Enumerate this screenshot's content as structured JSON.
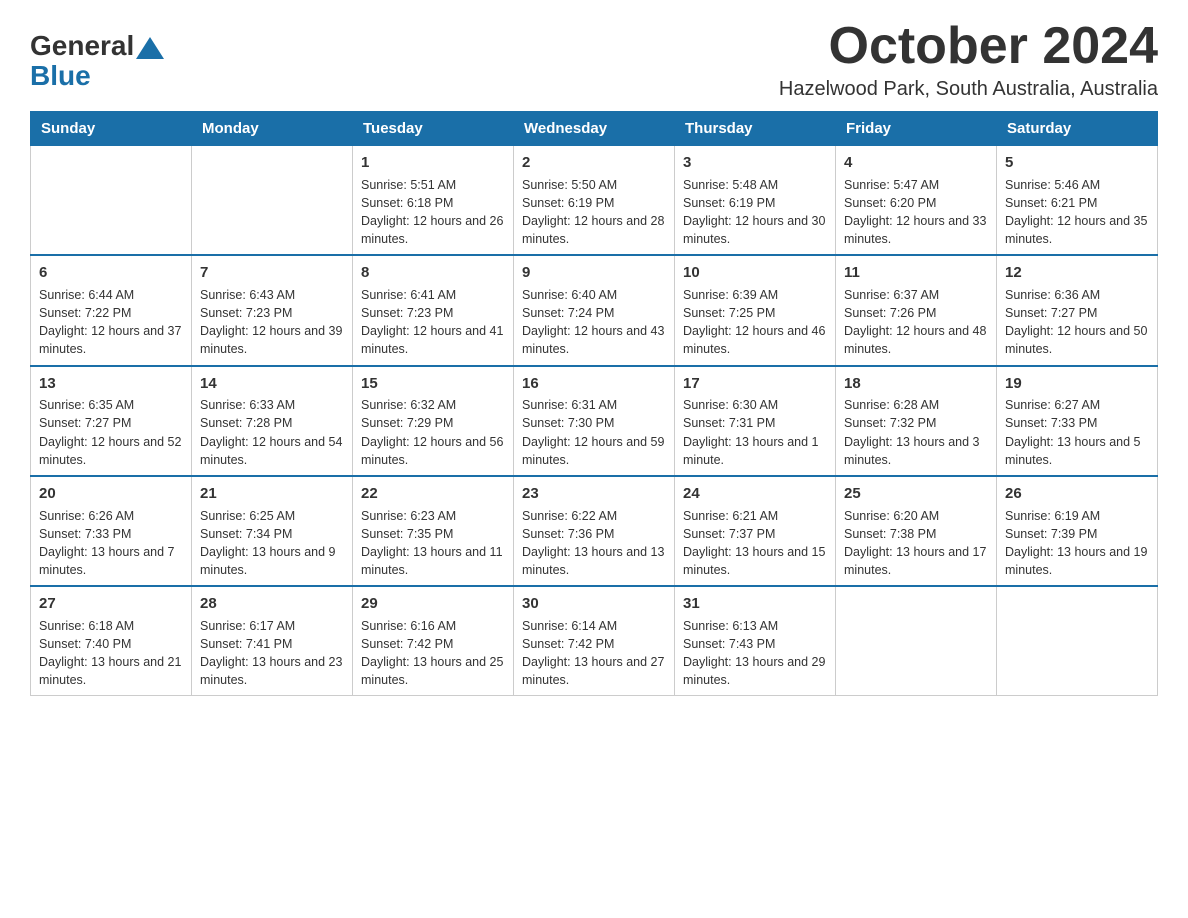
{
  "header": {
    "logo_general": "General",
    "logo_blue": "Blue",
    "month": "October 2024",
    "location": "Hazelwood Park, South Australia, Australia"
  },
  "days_of_week": [
    "Sunday",
    "Monday",
    "Tuesday",
    "Wednesday",
    "Thursday",
    "Friday",
    "Saturday"
  ],
  "weeks": [
    [
      {
        "day": "",
        "sunrise": "",
        "sunset": "",
        "daylight": ""
      },
      {
        "day": "",
        "sunrise": "",
        "sunset": "",
        "daylight": ""
      },
      {
        "day": "1",
        "sunrise": "Sunrise: 5:51 AM",
        "sunset": "Sunset: 6:18 PM",
        "daylight": "Daylight: 12 hours and 26 minutes."
      },
      {
        "day": "2",
        "sunrise": "Sunrise: 5:50 AM",
        "sunset": "Sunset: 6:19 PM",
        "daylight": "Daylight: 12 hours and 28 minutes."
      },
      {
        "day": "3",
        "sunrise": "Sunrise: 5:48 AM",
        "sunset": "Sunset: 6:19 PM",
        "daylight": "Daylight: 12 hours and 30 minutes."
      },
      {
        "day": "4",
        "sunrise": "Sunrise: 5:47 AM",
        "sunset": "Sunset: 6:20 PM",
        "daylight": "Daylight: 12 hours and 33 minutes."
      },
      {
        "day": "5",
        "sunrise": "Sunrise: 5:46 AM",
        "sunset": "Sunset: 6:21 PM",
        "daylight": "Daylight: 12 hours and 35 minutes."
      }
    ],
    [
      {
        "day": "6",
        "sunrise": "Sunrise: 6:44 AM",
        "sunset": "Sunset: 7:22 PM",
        "daylight": "Daylight: 12 hours and 37 minutes."
      },
      {
        "day": "7",
        "sunrise": "Sunrise: 6:43 AM",
        "sunset": "Sunset: 7:23 PM",
        "daylight": "Daylight: 12 hours and 39 minutes."
      },
      {
        "day": "8",
        "sunrise": "Sunrise: 6:41 AM",
        "sunset": "Sunset: 7:23 PM",
        "daylight": "Daylight: 12 hours and 41 minutes."
      },
      {
        "day": "9",
        "sunrise": "Sunrise: 6:40 AM",
        "sunset": "Sunset: 7:24 PM",
        "daylight": "Daylight: 12 hours and 43 minutes."
      },
      {
        "day": "10",
        "sunrise": "Sunrise: 6:39 AM",
        "sunset": "Sunset: 7:25 PM",
        "daylight": "Daylight: 12 hours and 46 minutes."
      },
      {
        "day": "11",
        "sunrise": "Sunrise: 6:37 AM",
        "sunset": "Sunset: 7:26 PM",
        "daylight": "Daylight: 12 hours and 48 minutes."
      },
      {
        "day": "12",
        "sunrise": "Sunrise: 6:36 AM",
        "sunset": "Sunset: 7:27 PM",
        "daylight": "Daylight: 12 hours and 50 minutes."
      }
    ],
    [
      {
        "day": "13",
        "sunrise": "Sunrise: 6:35 AM",
        "sunset": "Sunset: 7:27 PM",
        "daylight": "Daylight: 12 hours and 52 minutes."
      },
      {
        "day": "14",
        "sunrise": "Sunrise: 6:33 AM",
        "sunset": "Sunset: 7:28 PM",
        "daylight": "Daylight: 12 hours and 54 minutes."
      },
      {
        "day": "15",
        "sunrise": "Sunrise: 6:32 AM",
        "sunset": "Sunset: 7:29 PM",
        "daylight": "Daylight: 12 hours and 56 minutes."
      },
      {
        "day": "16",
        "sunrise": "Sunrise: 6:31 AM",
        "sunset": "Sunset: 7:30 PM",
        "daylight": "Daylight: 12 hours and 59 minutes."
      },
      {
        "day": "17",
        "sunrise": "Sunrise: 6:30 AM",
        "sunset": "Sunset: 7:31 PM",
        "daylight": "Daylight: 13 hours and 1 minute."
      },
      {
        "day": "18",
        "sunrise": "Sunrise: 6:28 AM",
        "sunset": "Sunset: 7:32 PM",
        "daylight": "Daylight: 13 hours and 3 minutes."
      },
      {
        "day": "19",
        "sunrise": "Sunrise: 6:27 AM",
        "sunset": "Sunset: 7:33 PM",
        "daylight": "Daylight: 13 hours and 5 minutes."
      }
    ],
    [
      {
        "day": "20",
        "sunrise": "Sunrise: 6:26 AM",
        "sunset": "Sunset: 7:33 PM",
        "daylight": "Daylight: 13 hours and 7 minutes."
      },
      {
        "day": "21",
        "sunrise": "Sunrise: 6:25 AM",
        "sunset": "Sunset: 7:34 PM",
        "daylight": "Daylight: 13 hours and 9 minutes."
      },
      {
        "day": "22",
        "sunrise": "Sunrise: 6:23 AM",
        "sunset": "Sunset: 7:35 PM",
        "daylight": "Daylight: 13 hours and 11 minutes."
      },
      {
        "day": "23",
        "sunrise": "Sunrise: 6:22 AM",
        "sunset": "Sunset: 7:36 PM",
        "daylight": "Daylight: 13 hours and 13 minutes."
      },
      {
        "day": "24",
        "sunrise": "Sunrise: 6:21 AM",
        "sunset": "Sunset: 7:37 PM",
        "daylight": "Daylight: 13 hours and 15 minutes."
      },
      {
        "day": "25",
        "sunrise": "Sunrise: 6:20 AM",
        "sunset": "Sunset: 7:38 PM",
        "daylight": "Daylight: 13 hours and 17 minutes."
      },
      {
        "day": "26",
        "sunrise": "Sunrise: 6:19 AM",
        "sunset": "Sunset: 7:39 PM",
        "daylight": "Daylight: 13 hours and 19 minutes."
      }
    ],
    [
      {
        "day": "27",
        "sunrise": "Sunrise: 6:18 AM",
        "sunset": "Sunset: 7:40 PM",
        "daylight": "Daylight: 13 hours and 21 minutes."
      },
      {
        "day": "28",
        "sunrise": "Sunrise: 6:17 AM",
        "sunset": "Sunset: 7:41 PM",
        "daylight": "Daylight: 13 hours and 23 minutes."
      },
      {
        "day": "29",
        "sunrise": "Sunrise: 6:16 AM",
        "sunset": "Sunset: 7:42 PM",
        "daylight": "Daylight: 13 hours and 25 minutes."
      },
      {
        "day": "30",
        "sunrise": "Sunrise: 6:14 AM",
        "sunset": "Sunset: 7:42 PM",
        "daylight": "Daylight: 13 hours and 27 minutes."
      },
      {
        "day": "31",
        "sunrise": "Sunrise: 6:13 AM",
        "sunset": "Sunset: 7:43 PM",
        "daylight": "Daylight: 13 hours and 29 minutes."
      },
      {
        "day": "",
        "sunrise": "",
        "sunset": "",
        "daylight": ""
      },
      {
        "day": "",
        "sunrise": "",
        "sunset": "",
        "daylight": ""
      }
    ]
  ]
}
